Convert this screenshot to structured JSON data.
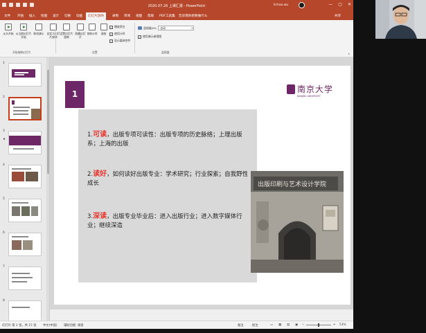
{
  "titlebar": {
    "title": "2020.07.26 上课汇报 - PowerPoint",
    "signin": "lichao.wu",
    "window_buttons": [
      "—",
      "▢",
      "✕"
    ]
  },
  "tabs": [
    {
      "label": "文件",
      "active": false
    },
    {
      "label": "开始",
      "active": false
    },
    {
      "label": "插入",
      "active": false
    },
    {
      "label": "绘图",
      "active": false
    },
    {
      "label": "设计",
      "active": false
    },
    {
      "label": "切换",
      "active": false
    },
    {
      "label": "动画",
      "active": false
    },
    {
      "label": "幻灯片放映",
      "active": true
    },
    {
      "label": "录制",
      "active": false
    },
    {
      "label": "审阅",
      "active": false
    },
    {
      "label": "视图",
      "active": false
    },
    {
      "label": "帮助",
      "active": false
    },
    {
      "label": "PDF工具集",
      "active": false
    },
    {
      "label": "告诉我你想要做什么",
      "active": false
    }
  ],
  "share_label": "共享",
  "ribbon": {
    "group1": {
      "buttons": [
        "从头开始",
        "从当前幻灯片开始",
        "联机演示",
        "自定义幻灯片放映"
      ],
      "label": "开始放映幻灯片"
    },
    "group2": {
      "buttons": [
        "设置幻灯片放映",
        "隐藏幻灯片",
        "排练计时",
        "录制"
      ],
      "checkboxes": [
        {
          "label": "播放旁白",
          "checked": true
        },
        {
          "label": "使用计时",
          "checked": true
        },
        {
          "label": "显示媒体控件",
          "checked": true
        }
      ],
      "label": "设置"
    },
    "group3": {
      "monitor_label": "监视器(M):",
      "monitor_value": "自动",
      "presenter_view": {
        "label": "使用演示者视图",
        "checked": true
      },
      "label": "监视器"
    }
  },
  "thumbnails": [
    {
      "number": "1",
      "selected": false
    },
    {
      "number": "2",
      "selected": true
    },
    {
      "number": "3",
      "selected": false
    },
    {
      "number": "4",
      "selected": false
    },
    {
      "number": "5",
      "selected": false
    },
    {
      "number": "6",
      "selected": false
    },
    {
      "number": "7",
      "selected": false
    },
    {
      "number": "8",
      "selected": false
    }
  ],
  "slide": {
    "number": "1",
    "logo_cn": "南京大学",
    "logo_en": "NANJING UNIVERSITY",
    "paragraphs": [
      {
        "prefix": "1.",
        "highlight": "可读",
        "text": "，出版专项可读性：出版专项的历史脉络；上理出版系；上海的出版"
      },
      {
        "prefix": "2.",
        "highlight": "读好",
        "text": "，如何读好出版专业：学术研究；行业探索；自我野性成长"
      },
      {
        "prefix": "3.",
        "highlight": "深读",
        "text": "，出版专业毕业后：进入出版行业；进入数字媒体行业；继续深造"
      }
    ],
    "photo_sign": "出版印刷与艺术设计学院"
  },
  "statusbar": {
    "slide_info": "幻灯片 第 2 张，共 15 张",
    "language": "中文(中国)",
    "accessibility": "辅助功能: 调查",
    "notes": "备注",
    "comments": "批注",
    "zoom": "53%"
  },
  "colors": {
    "accent": "#b7472a",
    "purple": "#6d2766",
    "highlight": "#e8352e"
  }
}
